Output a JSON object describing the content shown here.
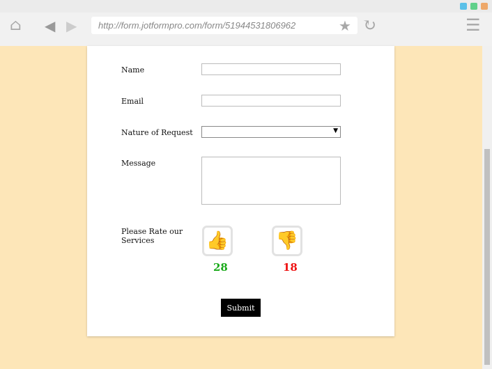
{
  "browser": {
    "url": "http://form.jotformpro.com/form/51944531806962"
  },
  "form": {
    "name_label": "Name",
    "email_label": "Email",
    "request_label": "Nature of Request",
    "request_value": "",
    "message_label": "Message",
    "rate_label": "Please Rate our Services",
    "thumbs_up_count": "28",
    "thumbs_down_count": "18",
    "submit_label": "Submit"
  },
  "colors": {
    "up": "#1aaa1a",
    "down": "#ee1111"
  }
}
